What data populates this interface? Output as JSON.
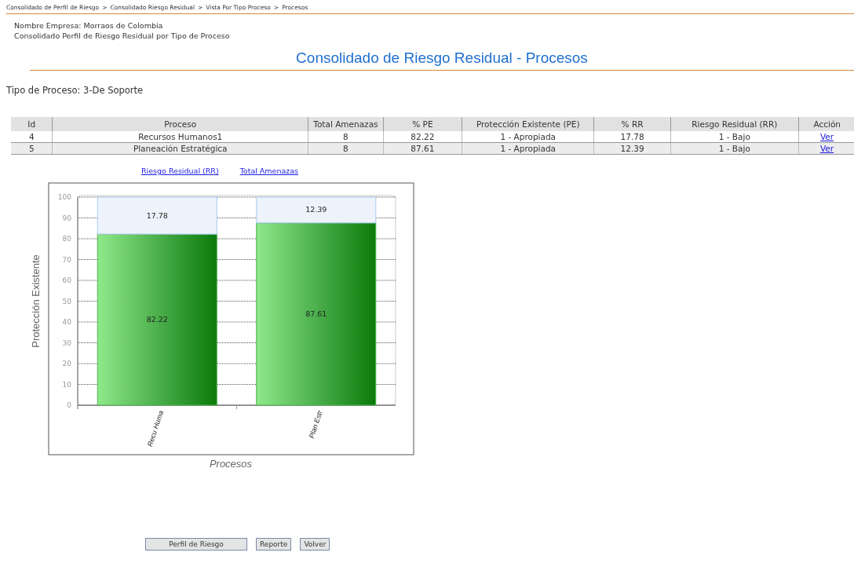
{
  "breadcrumb": [
    "Consolidado de Perfil de Riesgo",
    "Consolidado Riesgo Residual",
    "Vista Por Tipo Proceso",
    "Procesos"
  ],
  "breadcrumb_separator": ">",
  "company": {
    "label": "Nombre Empresa:",
    "value": "Morraos de Colombia"
  },
  "subtitle": "Consolidado Perfil de Riesgo Residual por Tipo de Proceso",
  "title": "Consolidado de Riesgo Residual - Procesos",
  "process_type": "Tipo de Proceso: 3-De Soporte",
  "table": {
    "columns": [
      "Id",
      "Proceso",
      "Total Amenazas",
      "% PE",
      "Protección Existente (PE)",
      "% RR",
      "Riesgo Residual (RR)",
      "Acción"
    ],
    "rows": [
      {
        "cells": [
          "4",
          "Recursos Humanos1",
          "8",
          "82.22",
          "1 - Apropiada",
          "17.78",
          "1 - Bajo"
        ],
        "action": "Ver"
      },
      {
        "cells": [
          "5",
          "Planeación Estratégica",
          "8",
          "87.61",
          "1 - Apropiada",
          "12.39",
          "1 - Bajo"
        ],
        "action": "Ver"
      }
    ]
  },
  "chart_links": [
    "Riesgo Residual (RR)",
    "Total Amenazas"
  ],
  "chart": {
    "chart_data": {
      "type": "bar",
      "stacked": true,
      "xlabel": "Procesos",
      "ylabel": "Protección Existente",
      "categories": [
        "Recu Huma",
        "Plan Estr"
      ],
      "series": [
        {
          "color": "#4cb04c",
          "values": [
            82.22,
            87.61
          ]
        },
        {
          "color": "#eef3fb",
          "values": [
            17.78,
            12.39
          ]
        }
      ],
      "grid": true,
      "ylim": [
        0,
        100
      ],
      "yticks": [
        0,
        10,
        20,
        30,
        40,
        50,
        60,
        70,
        80,
        90,
        100
      ],
      "data_labels": true
    }
  },
  "buttons": [
    "Perfil de Riesgo",
    "Reporte",
    "Volver"
  ]
}
